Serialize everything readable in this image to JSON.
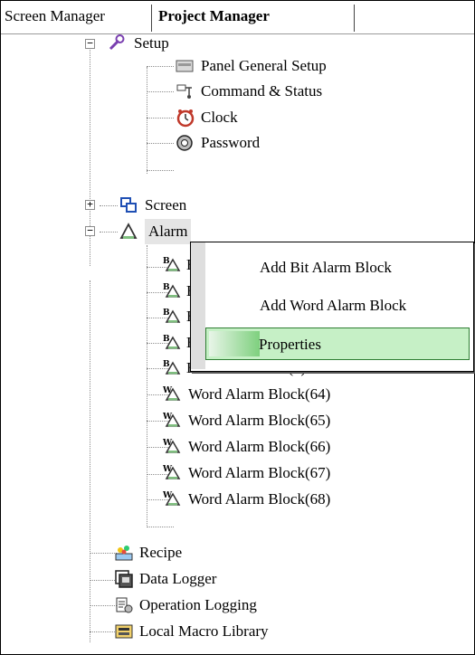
{
  "tabs": {
    "screen_manager": "Screen Manager",
    "project_manager": "Project Manager"
  },
  "tree": {
    "setup": "Setup",
    "panel_general_setup": "Panel General Setup",
    "command_status": "Command & Status",
    "clock": "Clock",
    "password": "Password",
    "screen": "Screen",
    "alarm": "Alarm",
    "bit_blocks_partial": [
      "B",
      "B",
      "B",
      "B"
    ],
    "bit_alarm_block_4": "Bit Alarm Block(4)",
    "word_alarm_blocks": [
      "Word Alarm Block(64)",
      "Word Alarm Block(65)",
      "Word Alarm Block(66)",
      "Word Alarm Block(67)",
      "Word Alarm Block(68)"
    ],
    "recipe": "Recipe",
    "data_logger": "Data Logger",
    "operation_logging": "Operation Logging",
    "local_macro_library": "Local Macro Library",
    "expand_plus": "+",
    "collapse_minus": "−"
  },
  "context_menu": {
    "add_bit_alarm_block": "Add Bit Alarm Block",
    "add_word_alarm_block": "Add Word Alarm Block",
    "properties": "Properties"
  },
  "icon_text": {
    "bit_badge": "B",
    "word_badge": "W"
  }
}
